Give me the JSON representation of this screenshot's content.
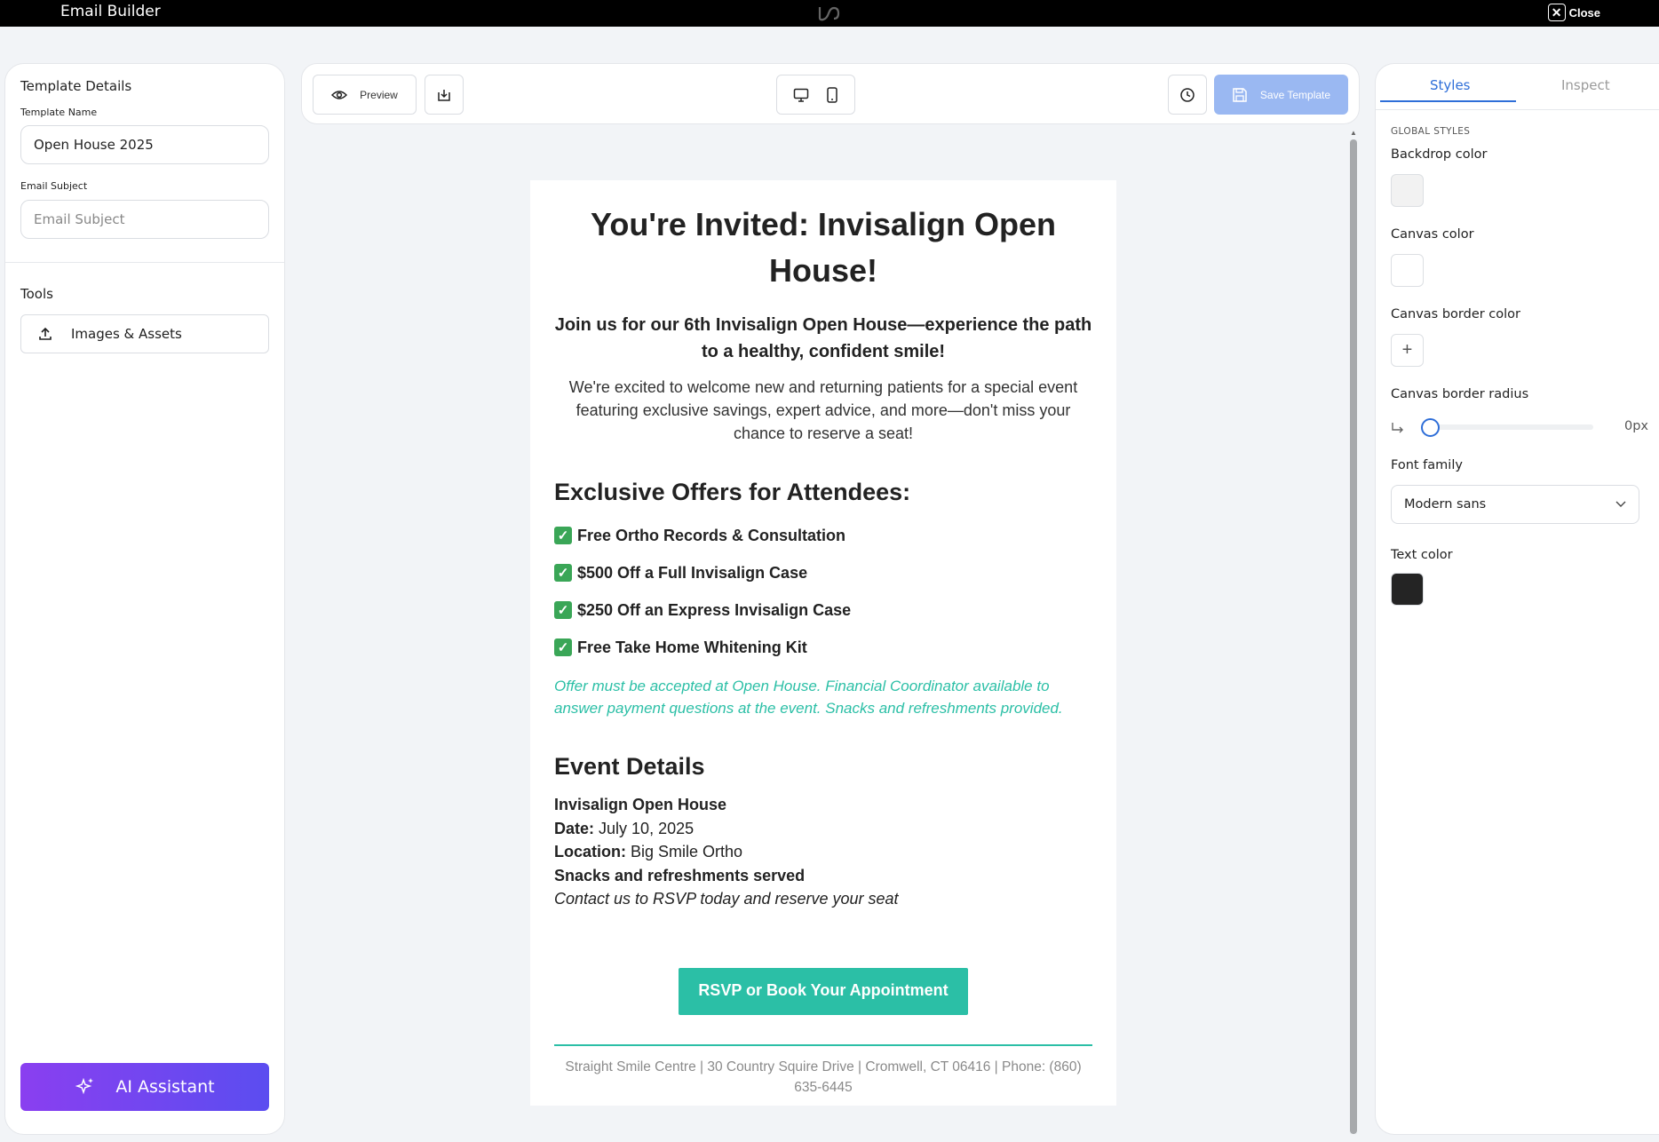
{
  "app": {
    "title": "Email Builder",
    "close_label": "Close"
  },
  "left": {
    "details_title": "Template Details",
    "template_name_label": "Template Name",
    "template_name_value": "Open House 2025",
    "email_subject_label": "Email Subject",
    "email_subject_placeholder": "Email Subject",
    "tools_title": "Tools",
    "images_assets_label": "Images & Assets",
    "ai_assistant_label": "AI Assistant"
  },
  "toolbar": {
    "preview_label": "Preview",
    "save_label": "Save Template"
  },
  "email": {
    "heading": "You're Invited: Invisalign Open House!",
    "subheading": "Join us for our 6th Invisalign Open House—experience the path to a healthy, confident smile!",
    "intro": "We're excited to welcome new and returning patients for a special event featuring exclusive savings, expert advice, and more—don't miss your chance to reserve a seat!",
    "offers_heading": "Exclusive Offers for Attendees:",
    "offers": [
      "Free Ortho Records & Consultation",
      "$500 Off a Full Invisalign Case",
      "$250 Off an Express Invisalign Case",
      "Free Take Home Whitening Kit"
    ],
    "note": "Offer must be accepted at Open House. Financial Coordinator available to answer payment questions at the event. Snacks and refreshments provided.",
    "event_heading": "Event Details",
    "event_name": "Invisalign Open House",
    "date_label": "Date:",
    "date_value": "July 10, 2025",
    "location_label": "Location:",
    "location_value": "Big Smile Ortho",
    "snacks": "Snacks and refreshments served",
    "contact": "Contact us to RSVP today and reserve your seat",
    "cta": "RSVP or Book Your Appointment",
    "footer": "Straight Smile Centre  |  30 Country Squire Drive  |  Cromwell, CT 06416  |  Phone: (860) 635-6445"
  },
  "right": {
    "tab_styles": "Styles",
    "tab_inspect": "Inspect",
    "global_styles": "GLOBAL STYLES",
    "backdrop_color_label": "Backdrop color",
    "canvas_color_label": "Canvas color",
    "canvas_border_color_label": "Canvas border color",
    "canvas_border_radius_label": "Canvas border radius",
    "canvas_border_radius_value": "0px",
    "font_family_label": "Font family",
    "font_family_value": "Modern sans",
    "text_color_label": "Text color"
  },
  "colors": {
    "accent": "#2bbfa6",
    "primary": "#2e6ed8",
    "backdrop": "#f2f2f2",
    "canvas": "#ffffff",
    "text": "#242424"
  }
}
